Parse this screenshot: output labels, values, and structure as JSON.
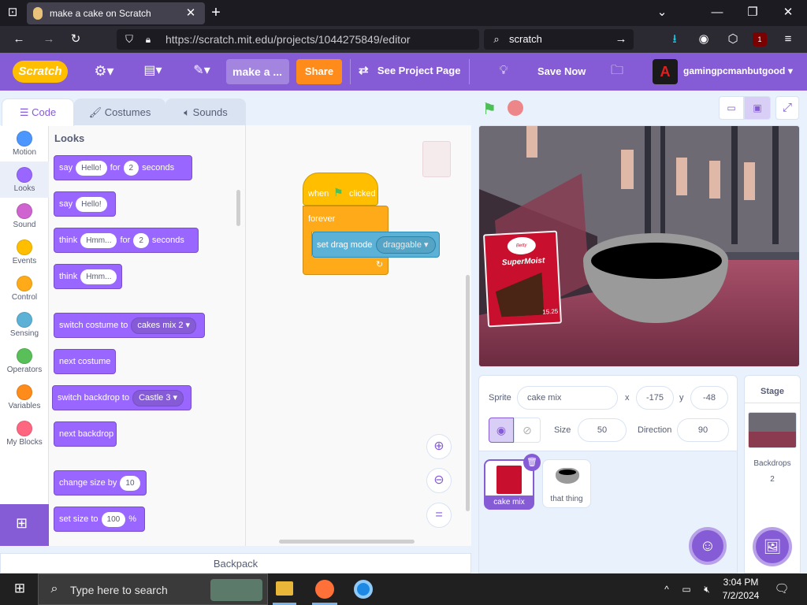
{
  "browser": {
    "tab_title": "make a cake on Scratch",
    "url": "https://scratch.mit.edu/projects/1044275849/editor",
    "search_text": "scratch",
    "ext_badge": "1"
  },
  "menubar": {
    "logo_text": "Scratch",
    "project_title": "make a ...",
    "share_label": "Share",
    "see_project_label": "See Project Page",
    "save_label": "Save Now",
    "username": "gamingpcmanbutgood",
    "accent": "#855cd6"
  },
  "tabs": {
    "code": "Code",
    "costumes": "Costumes",
    "sounds": "Sounds"
  },
  "categories": [
    {
      "label": "Motion",
      "color": "#4c97ff"
    },
    {
      "label": "Looks",
      "color": "#9966ff"
    },
    {
      "label": "Sound",
      "color": "#cf63cf"
    },
    {
      "label": "Events",
      "color": "#ffbf00"
    },
    {
      "label": "Control",
      "color": "#ffab19"
    },
    {
      "label": "Sensing",
      "color": "#5cb1d6"
    },
    {
      "label": "Operators",
      "color": "#59c059"
    },
    {
      "label": "Variables",
      "color": "#ff8c1a"
    },
    {
      "label": "My Blocks",
      "color": "#ff6680"
    }
  ],
  "palette": {
    "heading": "Looks",
    "say_for": {
      "a": "say",
      "msg": "Hello!",
      "b": "for",
      "secs": "2",
      "c": "seconds"
    },
    "say": {
      "a": "say",
      "msg": "Hello!"
    },
    "think_for": {
      "a": "think",
      "msg": "Hmm...",
      "b": "for",
      "secs": "2",
      "c": "seconds"
    },
    "think": {
      "a": "think",
      "msg": "Hmm..."
    },
    "switch_costume": {
      "a": "switch costume to",
      "value": "cakes mix 2"
    },
    "next_costume": "next costume",
    "switch_backdrop": {
      "a": "switch backdrop to",
      "value": "Castle 3"
    },
    "next_backdrop": "next backdrop",
    "change_size": {
      "a": "change size by",
      "value": "10"
    },
    "set_size": {
      "a": "set size to",
      "value": "100",
      "b": "%"
    }
  },
  "script": {
    "when_a": "when",
    "when_b": "clicked",
    "forever": "forever",
    "drag_a": "set drag mode",
    "drag_value": "draggable"
  },
  "sprite_info": {
    "sprite_label": "Sprite",
    "sprite_name": "cake mix",
    "x_label": "x",
    "x_value": "-175",
    "y_label": "y",
    "y_value": "-48",
    "size_label": "Size",
    "size_value": "50",
    "direction_label": "Direction",
    "direction_value": "90"
  },
  "sprites": [
    {
      "name": "cake mix",
      "selected": true
    },
    {
      "name": "that thing",
      "selected": false
    }
  ],
  "stage_panel": {
    "title": "Stage",
    "backdrops_label": "Backdrops",
    "backdrops_count": "2"
  },
  "backpack": "Backpack",
  "stage_art": {
    "box_brand": "Betty Crocker",
    "box_line": "SuperMoist",
    "box_weight": "15.25"
  },
  "taskbar": {
    "search_placeholder": "Type here to search",
    "time": "3:04 PM",
    "date": "7/2/2024"
  }
}
